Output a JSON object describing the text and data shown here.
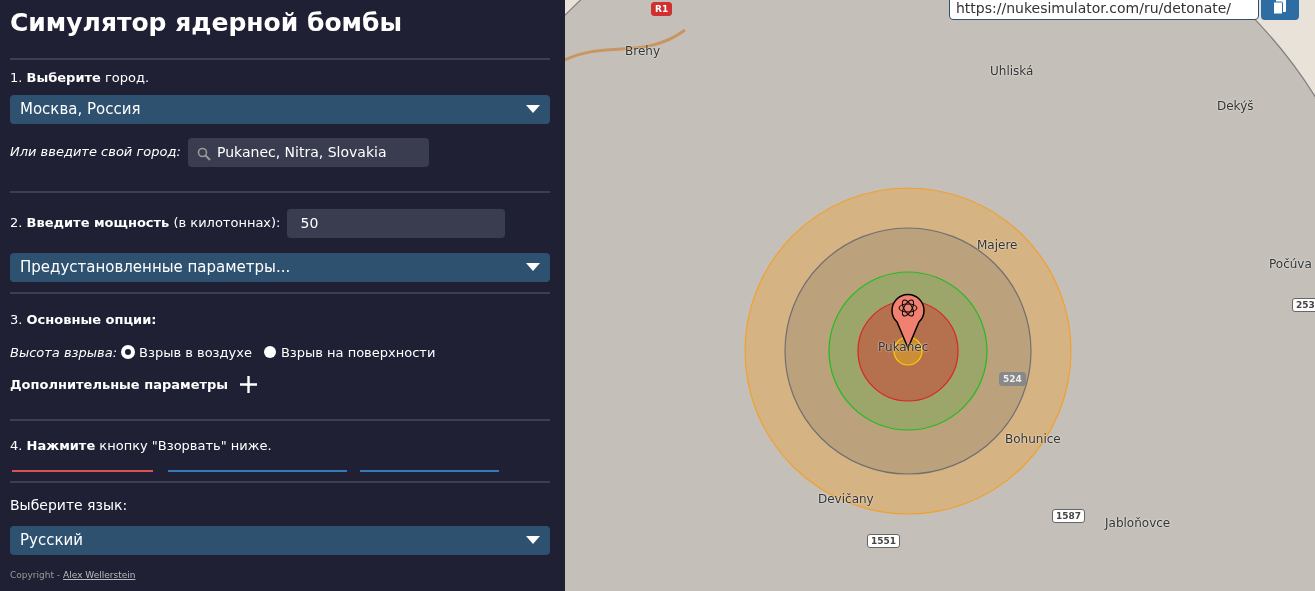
{
  "title": "Симулятор ядерной бомбы",
  "step1": {
    "text": "1. **Выберите** город.",
    "city_select": "Москва, Россия",
    "custom_label": "Или введите свой город:",
    "custom_value": "Pukanec, Nitra, Slovakia"
  },
  "step2": {
    "text": "2. **Введите мощность** (в килотоннах):",
    "yield_value": "50",
    "preset_select": "Предустановленные параметры..."
  },
  "step3": {
    "text": "3. **Основные опции:**",
    "height_label": "Высота взрыва:",
    "options": [
      {
        "label": "Взрыв в воздухе",
        "selected": true
      },
      {
        "label": "Взрыв на поверхности",
        "selected": false
      }
    ],
    "advanced": "Дополнительные параметры"
  },
  "step4": {
    "text": "4. **Нажмите** кнопку \"Взорвать\" ниже.",
    "button_edges": [
      {
        "color": "#d9534f"
      },
      {
        "color": "#337ab7"
      },
      {
        "color": "#337ab7"
      }
    ]
  },
  "language": {
    "label": "Выберите язык:",
    "select": "Русский"
  },
  "copyright": {
    "text": "Copyright -",
    "author": "Alex Wellerstein"
  },
  "map": {
    "url": "https://nukesimulator.com/ru/detonate/",
    "rings": [
      {
        "color": "#808080"
      },
      {
        "color": "#f0a030"
      },
      {
        "color": "#707070"
      },
      {
        "color": "#22bb22"
      },
      {
        "color": "#dd2222"
      },
      {
        "color": "#ffcc00"
      }
    ],
    "places": [
      {
        "name": "Brehy",
        "kind": "town"
      },
      {
        "name": "Uhliská",
        "kind": "town"
      },
      {
        "name": "Dekýš",
        "kind": "town"
      },
      {
        "name": "Majere",
        "kind": "town"
      },
      {
        "name": "Počúva",
        "kind": "town"
      },
      {
        "name": "Pukanec",
        "kind": "town"
      },
      {
        "name": "Bohunice",
        "kind": "town"
      },
      {
        "name": "Devičany",
        "kind": "town"
      },
      {
        "name": "Jabloňovce",
        "kind": "town"
      },
      {
        "name": "R1",
        "kind": "highway"
      },
      {
        "name": "524",
        "kind": "road"
      },
      {
        "name": "1587",
        "kind": "road"
      },
      {
        "name": "1551",
        "kind": "road"
      },
      {
        "name": "253",
        "kind": "road"
      }
    ]
  }
}
